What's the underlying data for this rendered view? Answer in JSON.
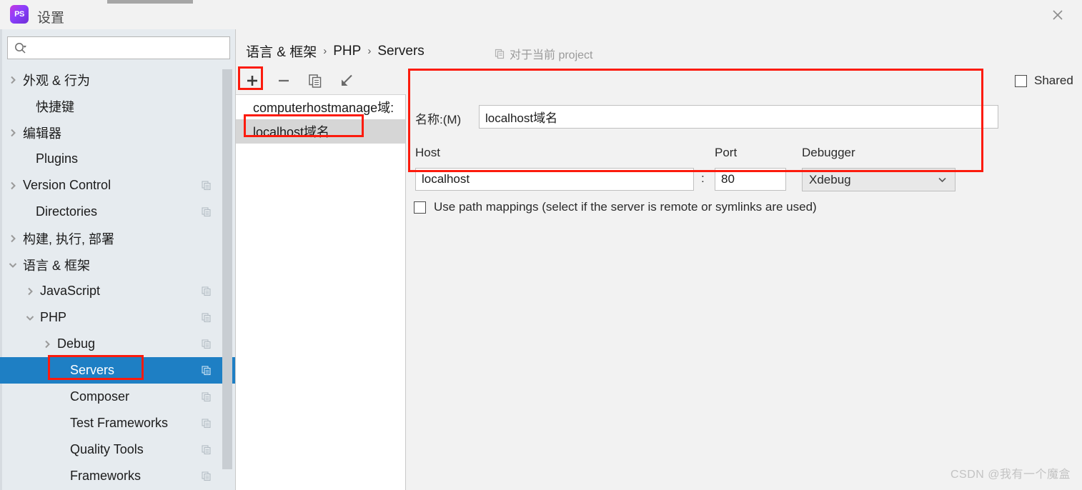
{
  "window": {
    "title": "设置",
    "logo_text": "PS",
    "close_icon": "close-icon"
  },
  "sidebar": {
    "search": {
      "placeholder": "",
      "value": "",
      "icon": "search-icon"
    },
    "items": [
      {
        "label": "外观 & 行为",
        "indent": 10,
        "arrow": "right",
        "copy": false,
        "selected": false
      },
      {
        "label": "快捷键",
        "indent": 28,
        "arrow": "none",
        "copy": false,
        "selected": false
      },
      {
        "label": "编辑器",
        "indent": 10,
        "arrow": "right",
        "copy": false,
        "selected": false
      },
      {
        "label": "Plugins",
        "indent": 28,
        "arrow": "none",
        "copy": false,
        "selected": false
      },
      {
        "label": "Version Control",
        "indent": 10,
        "arrow": "right",
        "copy": true,
        "selected": false
      },
      {
        "label": "Directories",
        "indent": 28,
        "arrow": "none",
        "copy": true,
        "selected": false
      },
      {
        "label": "构建, 执行, 部署",
        "indent": 10,
        "arrow": "right",
        "copy": false,
        "selected": false
      },
      {
        "label": "语言 & 框架",
        "indent": 10,
        "arrow": "down",
        "copy": false,
        "selected": false
      },
      {
        "label": "JavaScript",
        "indent": 34,
        "arrow": "right",
        "copy": true,
        "selected": false
      },
      {
        "label": "PHP",
        "indent": 34,
        "arrow": "down",
        "copy": true,
        "selected": false
      },
      {
        "label": "Debug",
        "indent": 58,
        "arrow": "right",
        "copy": true,
        "selected": false
      },
      {
        "label": "Servers",
        "indent": 76,
        "arrow": "none",
        "copy": true,
        "selected": true
      },
      {
        "label": "Composer",
        "indent": 76,
        "arrow": "none",
        "copy": true,
        "selected": false
      },
      {
        "label": "Test Frameworks",
        "indent": 76,
        "arrow": "none",
        "copy": true,
        "selected": false
      },
      {
        "label": "Quality Tools",
        "indent": 76,
        "arrow": "none",
        "copy": true,
        "selected": false
      },
      {
        "label": "Frameworks",
        "indent": 76,
        "arrow": "none",
        "copy": true,
        "selected": false
      }
    ]
  },
  "main": {
    "breadcrumb": [
      "语言 & 框架",
      "PHP",
      "Servers"
    ],
    "breadcrumb_separator": "›",
    "project_scope": "对于当前 project",
    "project_scope_icon": "copy-scope-icon",
    "toolbar": [
      {
        "name": "add-server-button",
        "icon": "plus-icon",
        "label": "+"
      },
      {
        "name": "remove-server-button",
        "icon": "minus-icon",
        "label": "−"
      },
      {
        "name": "copy-server-button",
        "icon": "copy-icon",
        "label": ""
      },
      {
        "name": "import-server-button",
        "icon": "import-arrow-icon",
        "label": ""
      }
    ],
    "servers": [
      {
        "label": "computerhostmanage域:",
        "selected": false
      },
      {
        "label": "localhost域名",
        "selected": true
      }
    ]
  },
  "form": {
    "name_label": "名称:(M)",
    "name_value": "localhost域名",
    "host_label": "Host",
    "host_value": "localhost",
    "colon": ":",
    "port_label": "Port",
    "port_value": "80",
    "debugger_label": "Debugger",
    "debugger_value": "Xdebug",
    "debugger_chevron": "chevron-down-icon",
    "shared_label": "Shared",
    "shared_checked": false,
    "path_mappings_label": "Use path mappings (select if the server is remote or symlinks are used)",
    "path_mappings_checked": false
  },
  "annotations": {
    "accent_color": "#fc1b0d",
    "selection_color": "#1e7fc4"
  },
  "watermark": "CSDN @我有一个魔盒"
}
